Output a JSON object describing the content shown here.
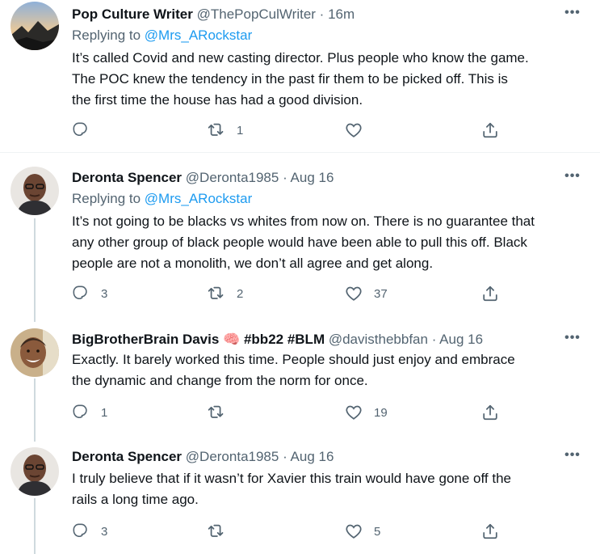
{
  "tweets": [
    {
      "name": "Pop Culture Writer",
      "handle": "@ThePopCulWriter",
      "time": "16m",
      "replying_label": "Replying to",
      "replying_to": "@Mrs_ARockstar",
      "lines": [
        "It’s called Covid and new casting director.  Plus people who know the game.",
        "The POC knew the tendency in the past fir them to be picked off.  This is",
        "the first time the house has had a good division."
      ],
      "replies": "",
      "retweets": "1",
      "likes": ""
    },
    {
      "name": "Deronta Spencer",
      "handle": "@Deronta1985",
      "time": "Aug 16",
      "replying_label": "Replying to",
      "replying_to": "@Mrs_ARockstar",
      "lines": [
        "It’s not going to be blacks vs whites from now on. There is no guarantee that",
        "any other group of black people would have been able to pull this off. Black",
        "people are not a monolith, we don’t all agree and get along."
      ],
      "replies": "3",
      "retweets": "2",
      "likes": "37"
    },
    {
      "name": "BigBrotherBrain Davis",
      "name_emoji": "🧠",
      "hashtags": "#bb22 #BLM",
      "handle": "@davisthebbfan",
      "time": "Aug 16",
      "lines": [
        "Exactly. It barely worked this time. People should just enjoy and embrace",
        "the dynamic and change from the norm for once."
      ],
      "replies": "1",
      "retweets": "",
      "likes": "19"
    },
    {
      "name": "Deronta Spencer",
      "handle": "@Deronta1985",
      "time": "Aug 16",
      "lines": [
        "I truly believe that if it wasn’t for Xavier this train would have gone off the",
        "rails a long time ago."
      ],
      "replies": "3",
      "retweets": "",
      "likes": "5"
    }
  ],
  "separator": "·",
  "more_glyph": "•••",
  "colors": {
    "link": "#1d9bf0",
    "secondary": "#536471",
    "text": "#0f1419",
    "thread": "#cfd9de"
  },
  "icons": [
    "reply-icon",
    "retweet-icon",
    "like-icon",
    "share-icon",
    "more-icon"
  ]
}
